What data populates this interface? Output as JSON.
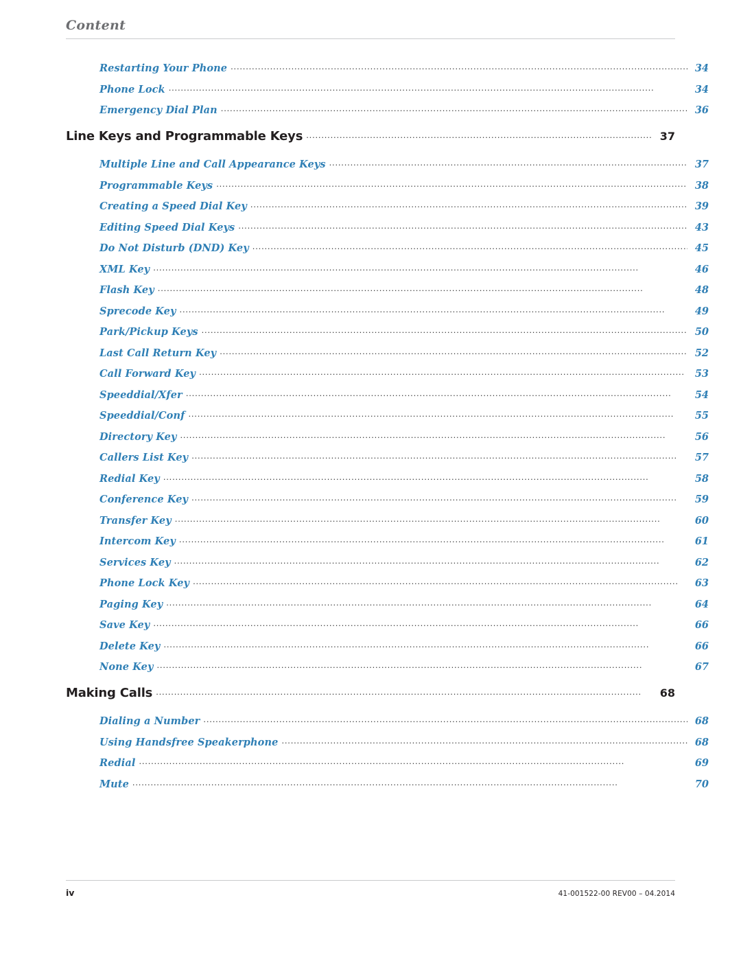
{
  "header": {
    "title": "Content"
  },
  "toc": {
    "entries": [
      {
        "level": 2,
        "label": "Restarting Your Phone",
        "page": "34"
      },
      {
        "level": 2,
        "label": "Phone Lock",
        "page": "34"
      },
      {
        "level": 2,
        "label": "Emergency Dial Plan",
        "page": "36"
      },
      {
        "level": 1,
        "label": "Line Keys and Programmable Keys",
        "page": "37"
      },
      {
        "level": 2,
        "label": "Multiple Line and Call Appearance Keys",
        "page": "37"
      },
      {
        "level": 2,
        "label": "Programmable Keys",
        "page": "38"
      },
      {
        "level": 2,
        "label": "Creating a Speed Dial Key",
        "page": "39"
      },
      {
        "level": 2,
        "label": "Editing Speed Dial Keys",
        "page": "43"
      },
      {
        "level": 2,
        "label": "Do Not Disturb (DND) Key",
        "page": "45"
      },
      {
        "level": 2,
        "label": "XML Key",
        "page": "46"
      },
      {
        "level": 2,
        "label": "Flash Key",
        "page": "48"
      },
      {
        "level": 2,
        "label": "Sprecode Key",
        "page": "49"
      },
      {
        "level": 2,
        "label": "Park/Pickup Keys",
        "page": "50"
      },
      {
        "level": 2,
        "label": "Last Call Return Key",
        "page": "52"
      },
      {
        "level": 2,
        "label": "Call Forward Key",
        "page": "53"
      },
      {
        "level": 2,
        "label": "Speeddial/Xfer",
        "page": "54"
      },
      {
        "level": 2,
        "label": "Speeddial/Conf",
        "page": "55"
      },
      {
        "level": 2,
        "label": "Directory Key",
        "page": "56"
      },
      {
        "level": 2,
        "label": "Callers List Key",
        "page": "57"
      },
      {
        "level": 2,
        "label": "Redial Key",
        "page": "58"
      },
      {
        "level": 2,
        "label": "Conference Key",
        "page": "59"
      },
      {
        "level": 2,
        "label": "Transfer Key",
        "page": "60"
      },
      {
        "level": 2,
        "label": "Intercom Key",
        "page": "61"
      },
      {
        "level": 2,
        "label": "Services Key",
        "page": "62"
      },
      {
        "level": 2,
        "label": "Phone Lock Key",
        "page": "63"
      },
      {
        "level": 2,
        "label": "Paging Key",
        "page": "64"
      },
      {
        "level": 2,
        "label": "Save Key",
        "page": "66"
      },
      {
        "level": 2,
        "label": "Delete Key",
        "page": "66"
      },
      {
        "level": 2,
        "label": "None Key",
        "page": "67"
      },
      {
        "level": 1,
        "label": "Making Calls",
        "page": "68"
      },
      {
        "level": 2,
        "label": "Dialing a Number",
        "page": "68"
      },
      {
        "level": 2,
        "label": "Using Handsfree Speakerphone",
        "page": "68"
      },
      {
        "level": 2,
        "label": "Redial",
        "page": "69"
      },
      {
        "level": 2,
        "label": "Mute",
        "page": "70"
      }
    ]
  },
  "footer": {
    "page_number": "iv",
    "document_id": "41-001522-00 REV00 – 04.2014"
  },
  "colors": {
    "link_blue": "#2f7fb5",
    "heading_gray": "#6d6e71",
    "body_black": "#231f20",
    "rule_gray": "#c9cacc"
  }
}
